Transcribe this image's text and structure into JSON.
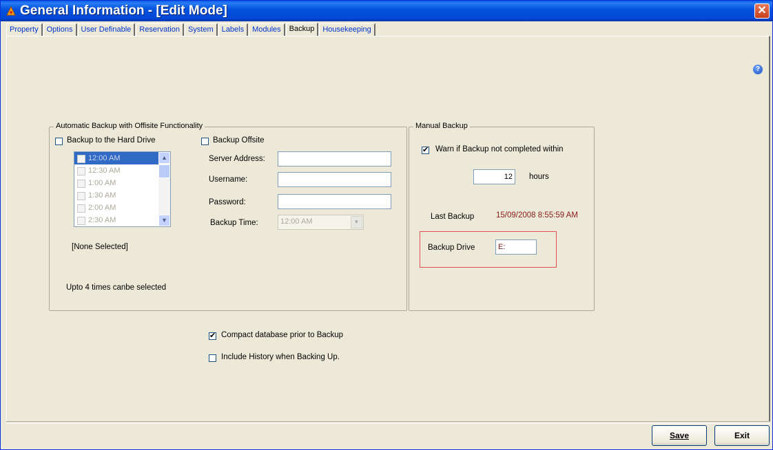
{
  "window": {
    "title": "General Information - [Edit Mode]",
    "close_label": "✕"
  },
  "tabs": [
    {
      "label": "Property"
    },
    {
      "label": "Options"
    },
    {
      "label": "User Definable"
    },
    {
      "label": "Reservation"
    },
    {
      "label": "System"
    },
    {
      "label": "Labels"
    },
    {
      "label": "Modules"
    },
    {
      "label": "Backup",
      "active": true
    },
    {
      "label": "Housekeeping"
    }
  ],
  "help_glyph": "?",
  "auto_backup": {
    "legend": "Automatic Backup with Offisite Functionality",
    "hard_drive_label": "Backup to the Hard Drive",
    "hard_drive_checked": false,
    "times": [
      "12:00 AM",
      "12:30 AM",
      "1:00 AM",
      "1:30 AM",
      "2:00 AM",
      "2:30 AM"
    ],
    "selected_time_index": 0,
    "none_selected": "[None Selected]",
    "note": "Upto 4 times canbe selected",
    "offsite_label": "Backup Offsite",
    "offsite_checked": false,
    "server_label": "Server Address:",
    "server_value": "",
    "username_label": "Username:",
    "username_value": "",
    "password_label": "Password:",
    "password_value": "",
    "backup_time_label": "Backup Time:",
    "backup_time_value": "12:00 AM"
  },
  "manual_backup": {
    "legend": "Manual Backup",
    "warn_label": "Warn if Backup not completed within",
    "warn_checked": true,
    "hours_value": "12",
    "hours_label": "hours",
    "last_backup_label": "Last Backup",
    "last_backup_value": "15/09/2008 8:55:59 AM",
    "drive_label": "Backup Drive",
    "drive_value": "E:"
  },
  "options": {
    "compact_label": "Compact database prior to Backup",
    "compact_checked": true,
    "history_label": "Include History when Backing Up.",
    "history_checked": false
  },
  "buttons": {
    "save": "Save",
    "exit": "Exit"
  },
  "colors": {
    "titlebar": "#0054e3",
    "last_backup_text": "#8b1a1a",
    "highlight_box": "#e05050",
    "selection": "#316ac5"
  }
}
